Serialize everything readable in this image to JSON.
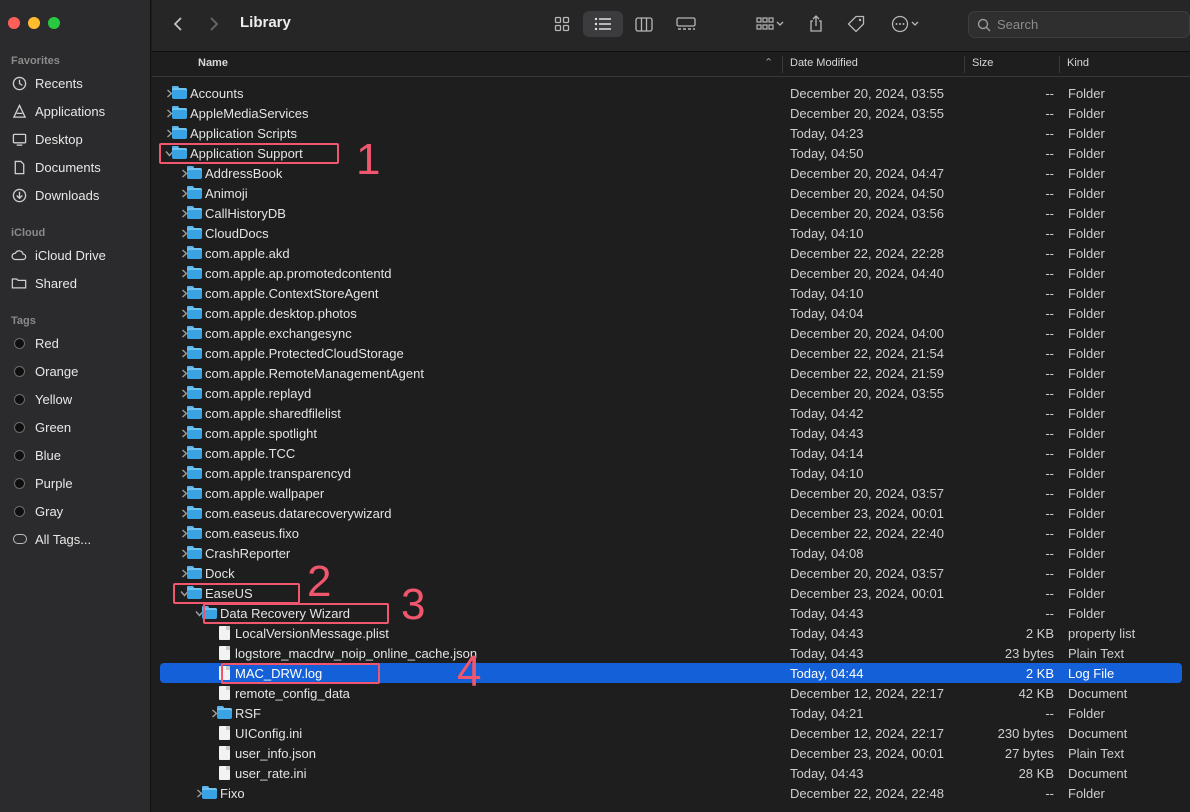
{
  "sidebar": {
    "favorites_label": "Favorites",
    "favorites": [
      {
        "label": "Recents",
        "icon": "clock-icon"
      },
      {
        "label": "Applications",
        "icon": "applications-icon"
      },
      {
        "label": "Desktop",
        "icon": "desktop-icon"
      },
      {
        "label": "Documents",
        "icon": "document-icon"
      },
      {
        "label": "Downloads",
        "icon": "download-icon"
      }
    ],
    "icloud_label": "iCloud",
    "icloud": [
      {
        "label": "iCloud Drive",
        "icon": "cloud-icon"
      },
      {
        "label": "Shared",
        "icon": "shared-folder-icon"
      }
    ],
    "tags_label": "Tags",
    "tags": [
      "Red",
      "Orange",
      "Yellow",
      "Green",
      "Blue",
      "Purple",
      "Gray"
    ],
    "all_tags": "All Tags..."
  },
  "toolbar": {
    "title": "Library",
    "search_placeholder": "Search"
  },
  "columns": {
    "name": "Name",
    "date": "Date Modified",
    "size": "Size",
    "kind": "Kind"
  },
  "rows": [
    {
      "name": "Accounts",
      "date": "December 20, 2024, 03:55",
      "size": "--",
      "kind": "Folder"
    },
    {
      "name": "AppleMediaServices",
      "date": "December 20, 2024, 03:55",
      "size": "--",
      "kind": "Folder"
    },
    {
      "name": "Application Scripts",
      "date": "Today, 04:23",
      "size": "--",
      "kind": "Folder"
    },
    {
      "name": "Application Support",
      "date": "Today, 04:50",
      "size": "--",
      "kind": "Folder"
    },
    {
      "name": "AddressBook",
      "date": "December 20, 2024, 04:47",
      "size": "--",
      "kind": "Folder"
    },
    {
      "name": "Animoji",
      "date": "December 20, 2024, 04:50",
      "size": "--",
      "kind": "Folder"
    },
    {
      "name": "CallHistoryDB",
      "date": "December 20, 2024, 03:56",
      "size": "--",
      "kind": "Folder"
    },
    {
      "name": "CloudDocs",
      "date": "Today, 04:10",
      "size": "--",
      "kind": "Folder"
    },
    {
      "name": "com.apple.akd",
      "date": "December 22, 2024, 22:28",
      "size": "--",
      "kind": "Folder"
    },
    {
      "name": "com.apple.ap.promotedcontentd",
      "date": "December 20, 2024, 04:40",
      "size": "--",
      "kind": "Folder"
    },
    {
      "name": "com.apple.ContextStoreAgent",
      "date": "Today, 04:10",
      "size": "--",
      "kind": "Folder"
    },
    {
      "name": "com.apple.desktop.photos",
      "date": "Today, 04:04",
      "size": "--",
      "kind": "Folder"
    },
    {
      "name": "com.apple.exchangesync",
      "date": "December 20, 2024, 04:00",
      "size": "--",
      "kind": "Folder"
    },
    {
      "name": "com.apple.ProtectedCloudStorage",
      "date": "December 22, 2024, 21:54",
      "size": "--",
      "kind": "Folder"
    },
    {
      "name": "com.apple.RemoteManagementAgent",
      "date": "December 22, 2024, 21:59",
      "size": "--",
      "kind": "Folder"
    },
    {
      "name": "com.apple.replayd",
      "date": "December 20, 2024, 03:55",
      "size": "--",
      "kind": "Folder"
    },
    {
      "name": "com.apple.sharedfilelist",
      "date": "Today, 04:42",
      "size": "--",
      "kind": "Folder"
    },
    {
      "name": "com.apple.spotlight",
      "date": "Today, 04:43",
      "size": "--",
      "kind": "Folder"
    },
    {
      "name": "com.apple.TCC",
      "date": "Today, 04:14",
      "size": "--",
      "kind": "Folder"
    },
    {
      "name": "com.apple.transparencyd",
      "date": "Today, 04:10",
      "size": "--",
      "kind": "Folder"
    },
    {
      "name": "com.apple.wallpaper",
      "date": "December 20, 2024, 03:57",
      "size": "--",
      "kind": "Folder"
    },
    {
      "name": "com.easeus.datarecoverywizard",
      "date": "December 23, 2024, 00:01",
      "size": "--",
      "kind": "Folder"
    },
    {
      "name": "com.easeus.fixo",
      "date": "December 22, 2024, 22:40",
      "size": "--",
      "kind": "Folder"
    },
    {
      "name": "CrashReporter",
      "date": "Today, 04:08",
      "size": "--",
      "kind": "Folder"
    },
    {
      "name": "Dock",
      "date": "December 20, 2024, 03:57",
      "size": "--",
      "kind": "Folder"
    },
    {
      "name": "EaseUS",
      "date": "December 23, 2024, 00:01",
      "size": "--",
      "kind": "Folder"
    },
    {
      "name": "Data Recovery Wizard",
      "date": "Today, 04:43",
      "size": "--",
      "kind": "Folder"
    },
    {
      "name": "LocalVersionMessage.plist",
      "date": "Today, 04:43",
      "size": "2 KB",
      "kind": "property list"
    },
    {
      "name": "logstore_macdrw_noip_online_cache.json",
      "date": "Today, 04:43",
      "size": "23 bytes",
      "kind": "Plain Text"
    },
    {
      "name": "MAC_DRW.log",
      "date": "Today, 04:44",
      "size": "2 KB",
      "kind": "Log File"
    },
    {
      "name": "remote_config_data",
      "date": "December 12, 2024, 22:17",
      "size": "42 KB",
      "kind": "Document"
    },
    {
      "name": "RSF",
      "date": "Today, 04:21",
      "size": "--",
      "kind": "Folder"
    },
    {
      "name": "UIConfig.ini",
      "date": "December 12, 2024, 22:17",
      "size": "230 bytes",
      "kind": "Document"
    },
    {
      "name": "user_info.json",
      "date": "December 23, 2024, 00:01",
      "size": "27 bytes",
      "kind": "Plain Text"
    },
    {
      "name": "user_rate.ini",
      "date": "Today, 04:43",
      "size": "28 KB",
      "kind": "Document"
    },
    {
      "name": "Fixo",
      "date": "December 22, 2024, 22:48",
      "size": "--",
      "kind": "Folder"
    }
  ],
  "annotations": [
    "1",
    "2",
    "3",
    "4"
  ],
  "colors": {
    "selection": "#1360d8",
    "annotation": "#f0566e",
    "folder": "#3aa3e4"
  }
}
